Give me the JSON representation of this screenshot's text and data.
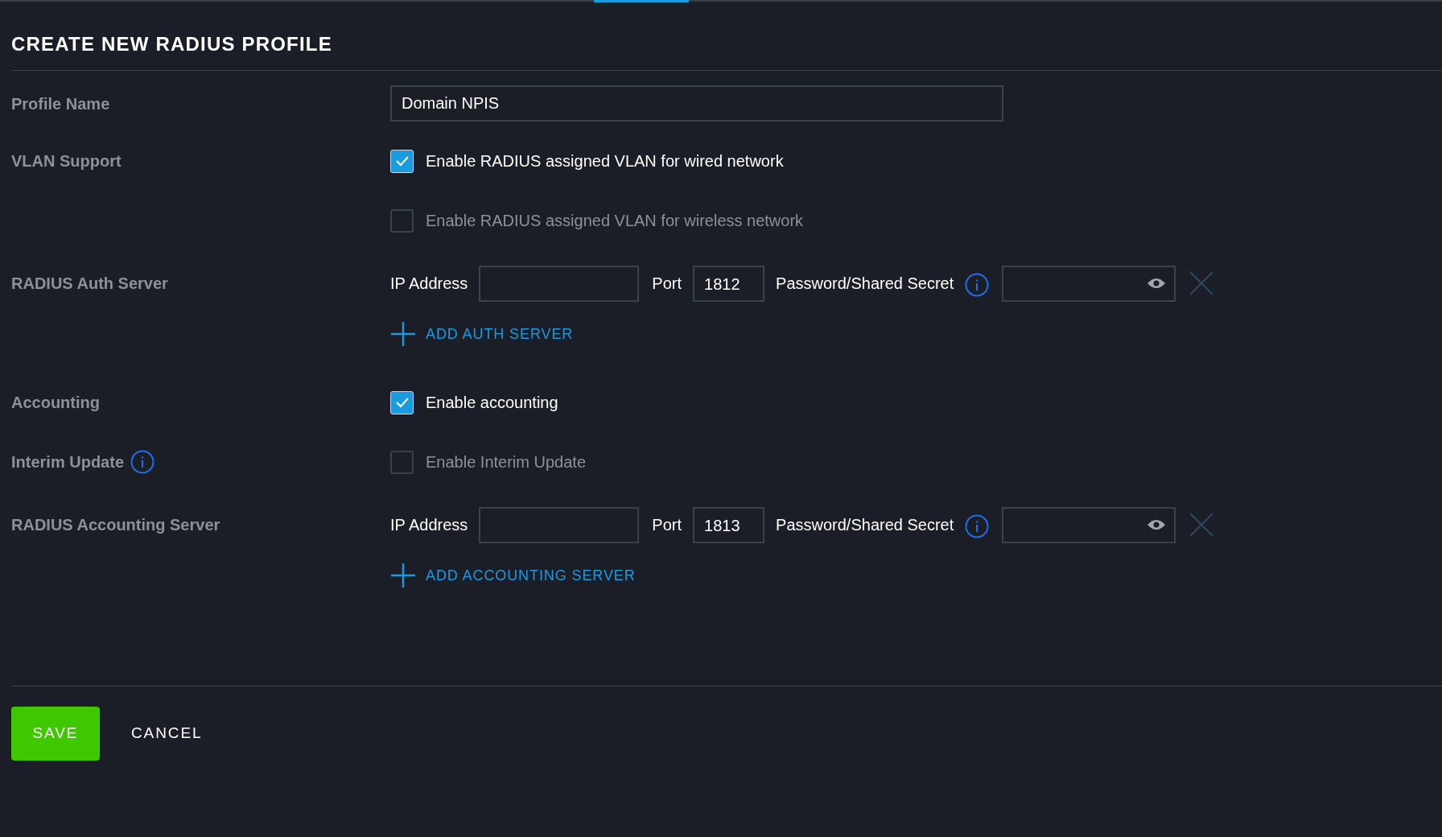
{
  "title": "CREATE NEW RADIUS PROFILE",
  "rows": [
    {
      "kind": "text",
      "label": "Profile Name",
      "value": "Domain NPIS"
    },
    {
      "kind": "checkbox",
      "label": "VLAN Support",
      "option": "Enable RADIUS assigned VLAN for wired network",
      "checked": true
    },
    {
      "kind": "checkbox",
      "option": "Enable RADIUS assigned VLAN for wireless network",
      "checked": false
    },
    {
      "kind": "server",
      "label": "RADIUS Auth Server",
      "ip_label": "IP Address",
      "port_label": "Port",
      "port": "1812",
      "secret_label": "Password/Shared Secret",
      "add_label": "ADD AUTH SERVER"
    },
    {
      "kind": "checkbox",
      "label": "Accounting",
      "option": "Enable accounting",
      "checked": true
    },
    {
      "kind": "checkbox",
      "label": "Interim Update",
      "info": true,
      "option": "Enable Interim Update",
      "checked": false
    },
    {
      "kind": "server",
      "label": "RADIUS Accounting Server",
      "ip_label": "IP Address",
      "port_label": "Port",
      "port": "1813",
      "secret_label": "Password/Shared Secret",
      "add_label": "ADD ACCOUNTING SERVER"
    }
  ],
  "buttons": {
    "save": "SAVE",
    "cancel": "CANCEL"
  }
}
